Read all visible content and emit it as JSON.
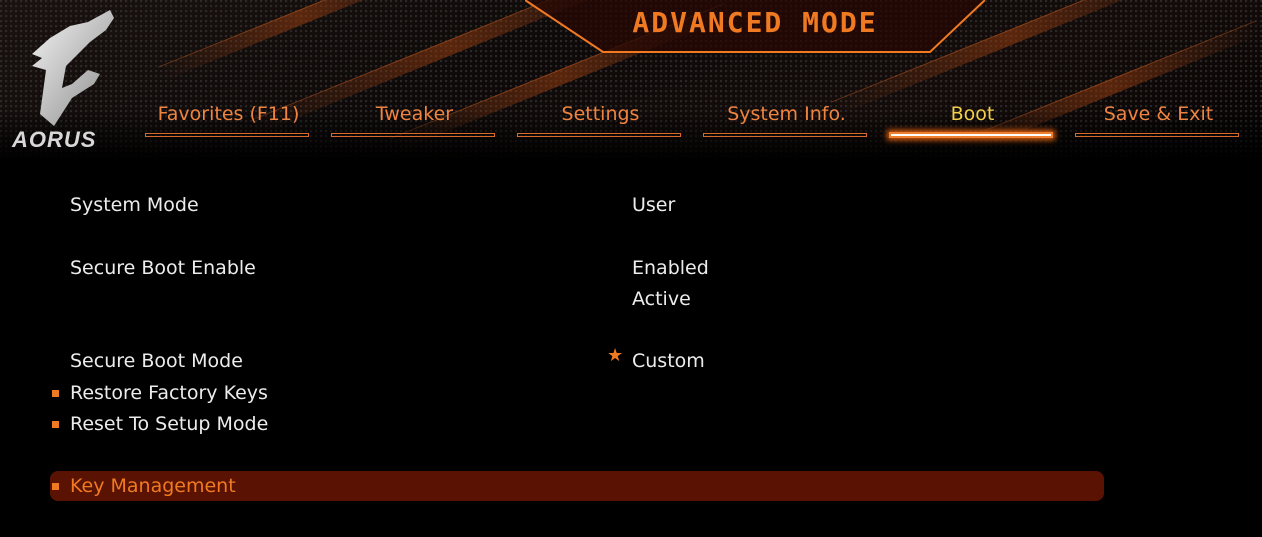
{
  "header": {
    "title": "ADVANCED MODE",
    "logo_text": "AORUS",
    "logo_icon": "aorus-eagle-icon"
  },
  "tabs": [
    {
      "label": "Favorites (F11)",
      "active": false
    },
    {
      "label": "Tweaker",
      "active": false
    },
    {
      "label": "Settings",
      "active": false
    },
    {
      "label": "System Info.",
      "active": false
    },
    {
      "label": "Boot",
      "active": true
    },
    {
      "label": "Save & Exit",
      "active": false
    }
  ],
  "settings": {
    "system_mode": {
      "label": "System Mode",
      "value": "User"
    },
    "secure_boot_enable": {
      "label": "Secure Boot Enable",
      "value": "Enabled",
      "status": "Active"
    },
    "secure_boot_mode": {
      "label": "Secure Boot Mode",
      "value": "Custom",
      "marker_icon": "star-icon"
    },
    "restore_factory_keys": {
      "label": "Restore Factory Keys"
    },
    "reset_to_setup_mode": {
      "label": "Reset To Setup Mode"
    },
    "key_management": {
      "label": "Key Management",
      "selected": true
    }
  },
  "colors": {
    "accent": "#f07a22",
    "active_tab": "#f3d04a",
    "selection": "#5a1302",
    "text": "#ececec"
  }
}
